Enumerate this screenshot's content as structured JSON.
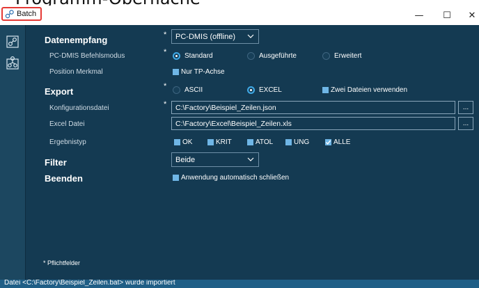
{
  "caption": "Programm-Oberfläche",
  "window": {
    "title": "Batch",
    "minimize": "—",
    "maximize": "☐",
    "close": "✕"
  },
  "sidebar": {
    "icons": [
      "batch-icon",
      "network-icon"
    ]
  },
  "required_star": "*",
  "sections": {
    "datenempfang": "Datenempfang",
    "export": "Export",
    "filter": "Filter",
    "beenden": "Beenden"
  },
  "datenempfang": {
    "source_value": "PC-DMIS (offline)",
    "befehlsmodus_label": "PC-DMIS Befehlsmodus",
    "modes": [
      "Standard",
      "Ausgeführte",
      "Erweitert"
    ],
    "selected_mode": "Standard",
    "merkmal_label": "Position Merkmal",
    "tp_achse_label": "Nur TP-Achse",
    "tp_achse_checked": false
  },
  "export": {
    "formats": [
      "ASCII",
      "EXCEL"
    ],
    "selected_format": "EXCEL",
    "two_files_label": "Zwei Dateien verwenden",
    "two_files_checked": false,
    "config_label": "Konfigurationsdatei",
    "config_value": "C:\\Factory\\Beispiel_Zeilen.json",
    "excel_label": "Excel Datei",
    "excel_value": "C:\\Factory\\Excel\\Beispiel_Zeilen.xls",
    "browse_label": "...",
    "result_label": "Ergebnistyp",
    "result_types": [
      {
        "label": "OK",
        "checked": false
      },
      {
        "label": "KRIT",
        "checked": false
      },
      {
        "label": "ATOL",
        "checked": false
      },
      {
        "label": "UNG",
        "checked": false
      },
      {
        "label": "ALLE",
        "checked": true
      }
    ]
  },
  "filter": {
    "value": "Beide"
  },
  "beenden": {
    "auto_close_label": "Anwendung automatisch schließen",
    "auto_close_checked": false
  },
  "footnote": "* Pflichtfelder",
  "status": "Datei <C:\\Factory\\Beispiel_Zeilen.bat> wurde importiert",
  "colors": {
    "background": "#143a52",
    "sidebar": "#1c4760",
    "accent": "#3fa9e6",
    "statusbar": "#1f5e86",
    "checkbox": "#6fb6e6"
  }
}
